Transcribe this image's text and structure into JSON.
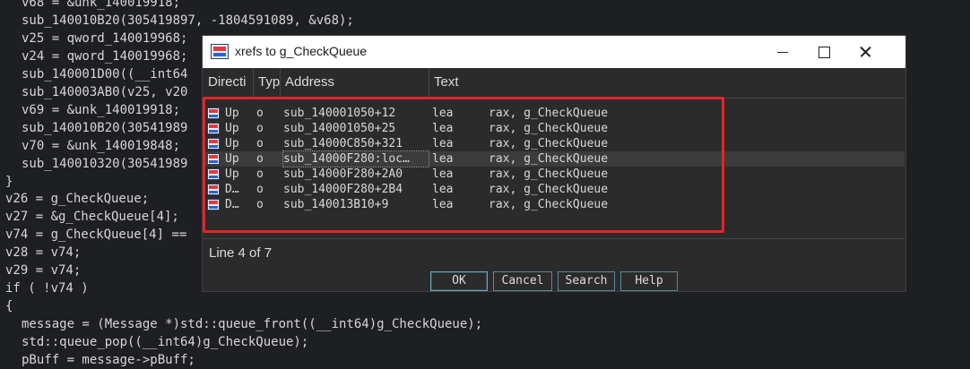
{
  "code": {
    "lines": [
      {
        "indent": true,
        "text": "v68 = &unk_140019918;"
      },
      {
        "indent": true,
        "text": "sub_140010B20(305419897, -1804591089, &v68);"
      },
      {
        "indent": true,
        "text": "v25 = qword_140019968;"
      },
      {
        "indent": true,
        "text": "v24 = qword_140019968;"
      },
      {
        "indent": true,
        "text": "sub_140001D00((__int64"
      },
      {
        "indent": true,
        "text": "sub_140003AB0(v25, v20"
      },
      {
        "indent": true,
        "text": "v69 = &unk_140019918;"
      },
      {
        "indent": true,
        "text": "sub_140010B20(30541989"
      },
      {
        "indent": true,
        "text": "v70 = &unk_140019848;"
      },
      {
        "indent": true,
        "text": "sub_140010320(30541989"
      },
      {
        "indent": false,
        "text": "}"
      },
      {
        "indent": false,
        "text": "v26 = g_CheckQueue;"
      },
      {
        "indent": false,
        "text": "v27 = &g_CheckQueue[4];"
      },
      {
        "indent": false,
        "text": "v74 = g_CheckQueue[4] =="
      },
      {
        "indent": false,
        "text": "v28 = v74;"
      },
      {
        "indent": false,
        "text": "v29 = v74;"
      },
      {
        "indent": false,
        "text": "if ( !v74 )"
      },
      {
        "indent": false,
        "text": "{"
      },
      {
        "indent": true,
        "text": "message = (Message *)std::queue_front((__int64)g_CheckQueue);"
      },
      {
        "indent": true,
        "text": "std::queue_pop((__int64)g_CheckQueue);"
      },
      {
        "indent": true,
        "text": "pBuff = message->pBuff;"
      }
    ]
  },
  "dialog": {
    "title": "xrefs to g_CheckQueue",
    "columns": [
      "Directi",
      "Typ",
      "Address",
      "Text"
    ],
    "rows": [
      {
        "direction": "Up",
        "type": "o",
        "address": "sub_140001050+12",
        "mnemonic": "lea",
        "operands": "rax, g_CheckQueue",
        "selected": false
      },
      {
        "direction": "Up",
        "type": "o",
        "address": "sub_140001050+25",
        "mnemonic": "lea",
        "operands": "rax, g_CheckQueue",
        "selected": false
      },
      {
        "direction": "Up",
        "type": "o",
        "address": "sub_14000C850+321",
        "mnemonic": "lea",
        "operands": "rax, g_CheckQueue",
        "selected": false
      },
      {
        "direction": "Up",
        "type": "o",
        "address": "sub_14000F280:loc…",
        "mnemonic": "lea",
        "operands": "rax, g_CheckQueue",
        "selected": true
      },
      {
        "direction": "Up",
        "type": "o",
        "address": "sub_14000F280+2A0",
        "mnemonic": "lea",
        "operands": "rax, g_CheckQueue",
        "selected": false
      },
      {
        "direction": "D…",
        "type": "o",
        "address": "sub_14000F280+2B4",
        "mnemonic": "lea",
        "operands": "rax, g_CheckQueue",
        "selected": false
      },
      {
        "direction": "D…",
        "type": "o",
        "address": "sub_140013B10+9",
        "mnemonic": "lea",
        "operands": "rax, g_CheckQueue",
        "selected": false
      }
    ],
    "status": "Line 4 of 7",
    "buttons": {
      "ok": "OK",
      "cancel": "Cancel",
      "search": "Search",
      "help": "Help"
    }
  }
}
